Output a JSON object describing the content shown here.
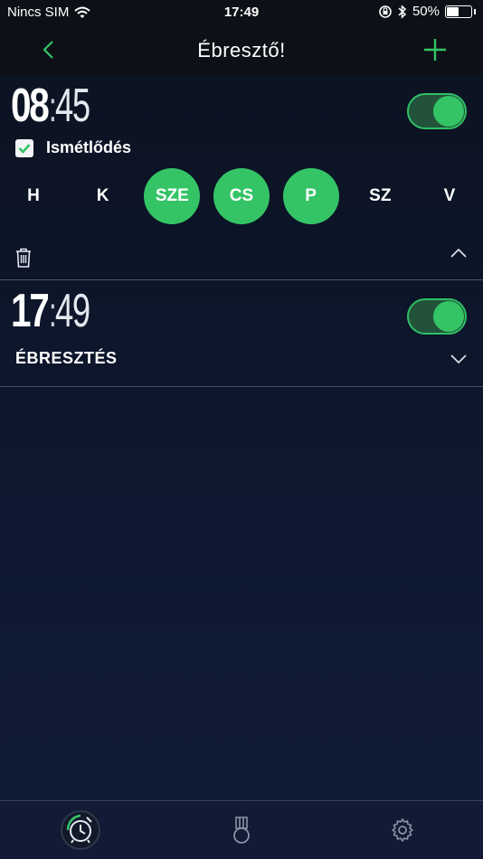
{
  "status_bar": {
    "carrier": "Nincs SIM",
    "time": "17:49",
    "battery": "50%",
    "battery_level": 0.5
  },
  "nav": {
    "title": "Ébresztő!"
  },
  "alarms": [
    {
      "hours": "08",
      "separator": ":",
      "minutes": "45",
      "enabled": true,
      "repeat_label": "Ismétlődés",
      "repeat_checked": true,
      "days": [
        {
          "label": "H",
          "active": false
        },
        {
          "label": "K",
          "active": false
        },
        {
          "label": "SZE",
          "active": true
        },
        {
          "label": "CS",
          "active": true
        },
        {
          "label": "P",
          "active": true
        },
        {
          "label": "SZ",
          "active": false
        },
        {
          "label": "V",
          "active": false
        }
      ]
    },
    {
      "hours": "17",
      "separator": ":",
      "minutes": "49",
      "enabled": true,
      "label": "ÉBRESZTÉS"
    }
  ],
  "colors": {
    "accent": "#34c466",
    "toggle_track": "#22533a",
    "background": "#0e1830",
    "bar": "#0d1117"
  },
  "icons": {
    "back": "chevron-left-icon",
    "add": "plus-icon",
    "delete": "trash-icon",
    "collapse": "chevron-up-icon",
    "expand": "chevron-down-icon",
    "tab_alarm": "alarm-clock-icon",
    "tab_achievements": "medal-icon",
    "tab_settings": "gear-icon"
  }
}
